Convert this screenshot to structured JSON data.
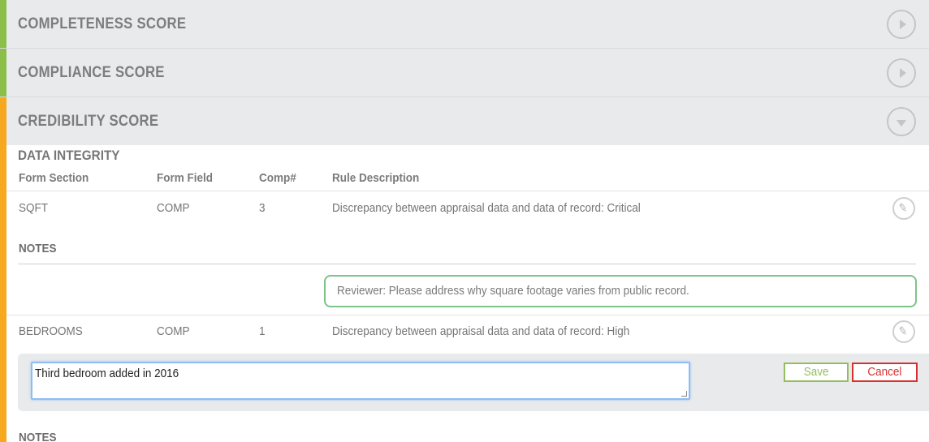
{
  "sections": {
    "completeness": {
      "title": "COMPLETENESS SCORE",
      "accent": "#8cbf4a"
    },
    "compliance": {
      "title": "COMPLIANCE SCORE",
      "accent": "#8cbf4a"
    },
    "credibility": {
      "title": "CREDIBILITY SCORE",
      "accent": "#f6a91e"
    }
  },
  "data_integrity": {
    "heading": "DATA INTEGRITY",
    "columns": [
      "Form Section",
      "Form Field",
      "Comp#",
      "Rule Description"
    ],
    "rows": [
      {
        "form_section": "SQFT",
        "form_field": "COMP",
        "comp": "3",
        "rule_description": "Discrepancy between appraisal data and data of record: Critical",
        "notes_label": "NOTES",
        "note": "Reviewer: Please address why square footage varies from public record."
      },
      {
        "form_section": "BEDROOMS",
        "form_field": "COMP",
        "comp": "1",
        "rule_description": "Discrepancy between appraisal data and data of record: High",
        "edit_value": "Third bedroom added in 2016",
        "notes_label": "NOTES"
      }
    ]
  },
  "buttons": {
    "save": "Save",
    "cancel": "Cancel"
  },
  "icons": {
    "expand": "play-circle-icon",
    "collapse": "chevron-down-circle-icon",
    "edit": "pencil-icon"
  },
  "colors": {
    "pass_accent": "#8cbf4a",
    "warn_accent": "#f6a91e",
    "note_border": "#7dc38a",
    "save": "#95bd5f",
    "cancel": "#d9302f"
  }
}
